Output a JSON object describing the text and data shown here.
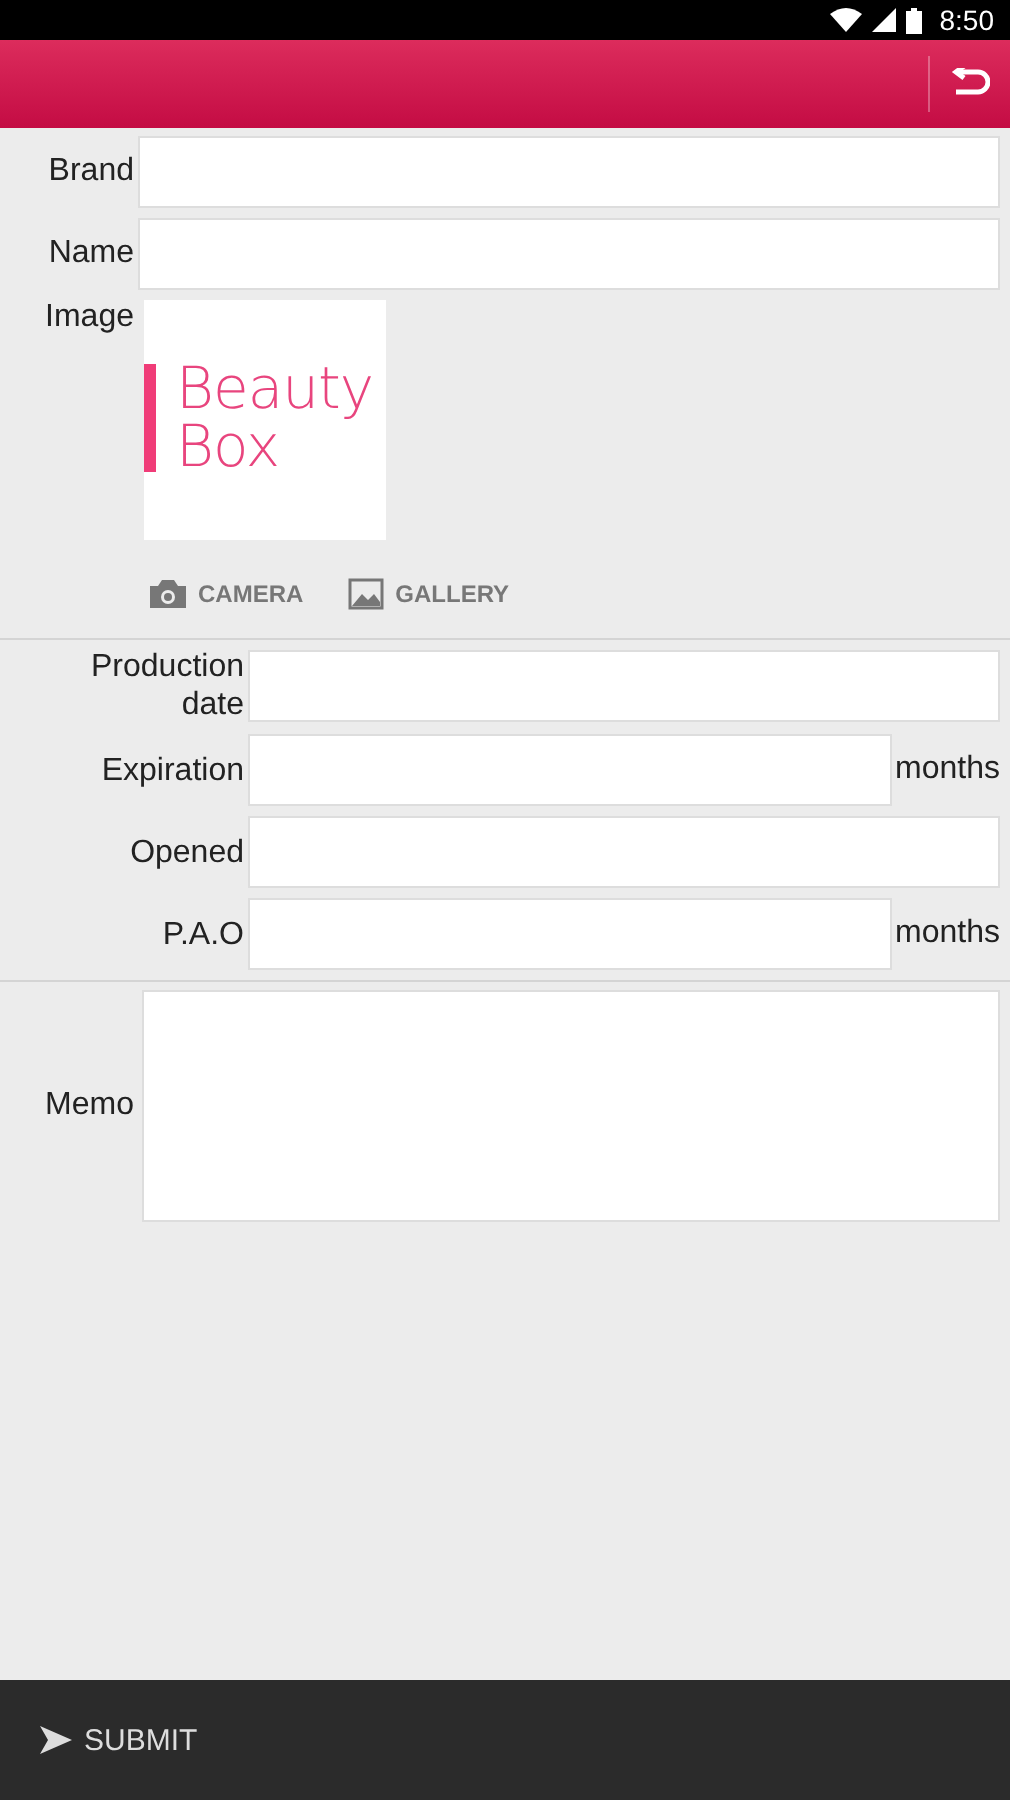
{
  "status_bar": {
    "time": "8:50"
  },
  "top_fields": [
    {
      "label": "Brand"
    },
    {
      "label": "Name"
    }
  ],
  "image": {
    "label": "Image",
    "logo_lines": [
      "Beauty",
      "Box"
    ]
  },
  "image_actions": [
    {
      "kind": "camera",
      "label": "CAMERA"
    },
    {
      "kind": "gallery",
      "label": "GALLERY"
    }
  ],
  "date_fields": [
    {
      "label": "Production date"
    },
    {
      "label": "Expiration",
      "unit": "months"
    },
    {
      "label": "Opened"
    },
    {
      "label": "P.A.O",
      "unit": "months"
    }
  ],
  "memo": {
    "label": "Memo"
  },
  "submit": {
    "label": "SUBMIT"
  }
}
